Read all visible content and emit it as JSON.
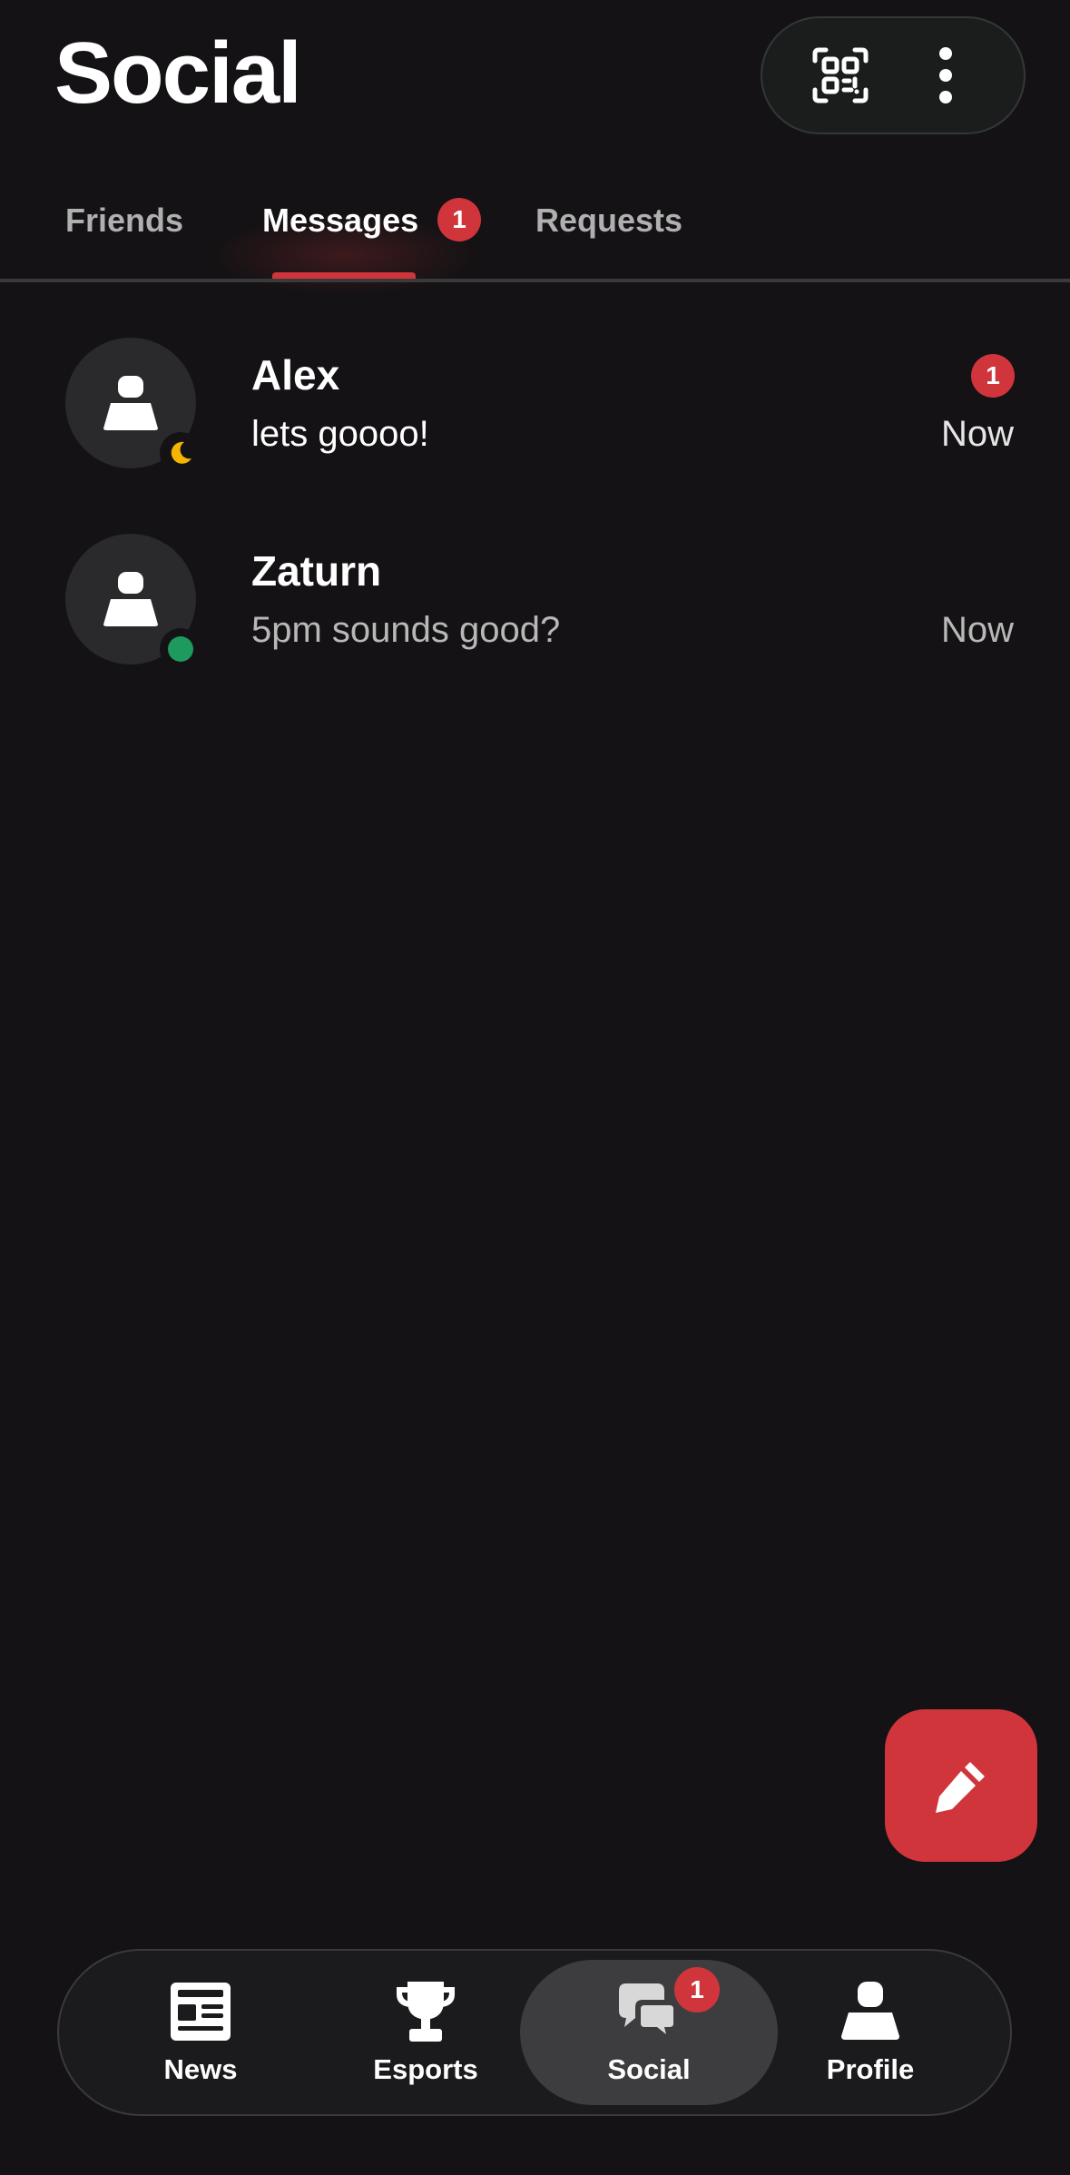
{
  "header": {
    "title": "Social",
    "actions": [
      {
        "icon": "qr-code-icon"
      },
      {
        "icon": "more-vertical-icon"
      }
    ]
  },
  "tabs": [
    {
      "label": "Friends",
      "active": false
    },
    {
      "label": "Messages",
      "active": true,
      "badge": "1"
    },
    {
      "label": "Requests",
      "active": false
    }
  ],
  "conversations": [
    {
      "name": "Alex",
      "preview": "lets goooo!",
      "time": "Now",
      "unread": "1",
      "status": "away",
      "status_icon": "moon-icon"
    },
    {
      "name": "Zaturn",
      "preview": "5pm sounds good?",
      "time": "Now",
      "status": "online"
    }
  ],
  "fab": {
    "icon": "pencil-icon"
  },
  "bottom_nav": [
    {
      "label": "News",
      "icon": "newspaper-icon",
      "active": false
    },
    {
      "label": "Esports",
      "icon": "trophy-icon",
      "active": false
    },
    {
      "label": "Social",
      "icon": "chat-bubbles-icon",
      "active": true,
      "badge": "1"
    },
    {
      "label": "Profile",
      "icon": "person-icon",
      "active": false
    }
  ],
  "colors": {
    "background": "#141214",
    "accent": "#d0353c",
    "online": "#1e9a5f",
    "away": "#f5b400"
  }
}
